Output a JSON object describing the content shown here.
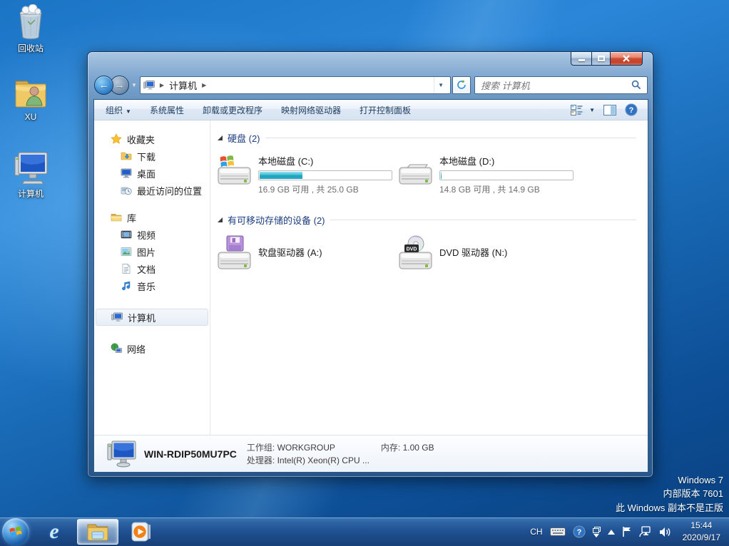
{
  "desktop": {
    "icons": [
      {
        "label": "回收站"
      },
      {
        "label": "XU"
      },
      {
        "label": "计算机"
      }
    ],
    "watermark": {
      "line1": "Windows 7",
      "line2": "内部版本 7601",
      "line3": "此 Windows 副本不是正版"
    }
  },
  "window": {
    "nav": {
      "breadcrumb_root": "计算机",
      "search_placeholder": "搜索 计算机"
    },
    "toolbar": {
      "organize": "组织",
      "items": [
        "系统属性",
        "卸载或更改程序",
        "映射网络驱动器",
        "打开控制面板"
      ]
    },
    "sidebar": {
      "items": [
        {
          "label": "收藏夹"
        },
        {
          "label": "下载"
        },
        {
          "label": "桌面"
        },
        {
          "label": "最近访问的位置"
        },
        {
          "label": "库"
        },
        {
          "label": "视频"
        },
        {
          "label": "图片"
        },
        {
          "label": "文档"
        },
        {
          "label": "音乐"
        },
        {
          "label": "计算机"
        },
        {
          "label": "网络"
        }
      ]
    },
    "content": {
      "groups": [
        {
          "title": "硬盘 (2)",
          "items": [
            {
              "name": "本地磁盘 (C:)",
              "capacity_text": "16.9 GB 可用 , 共 25.0 GB",
              "usage_percent": 32.4
            },
            {
              "name": "本地磁盘 (D:)",
              "capacity_text": "14.8 GB 可用 , 共 14.9 GB",
              "usage_percent": 0.7
            }
          ]
        },
        {
          "title": "有可移动存储的设备 (2)",
          "items": [
            {
              "name": "软盘驱动器 (A:)"
            },
            {
              "name": "DVD 驱动器 (N:)"
            }
          ]
        }
      ],
      "dvd_badge": "DVD"
    },
    "details": {
      "computer_name": "WIN-RDIP50MU7PC",
      "workgroup_label": "工作组:",
      "workgroup_value": "WORKGROUP",
      "memory_label": "内存:",
      "memory_value": "1.00 GB",
      "processor_label": "处理器:",
      "processor_value": "Intel(R) Xeon(R) CPU ..."
    }
  },
  "taskbar": {
    "tray": {
      "input_indicator": "CH",
      "time": "15:44",
      "date": "2020/9/17"
    }
  },
  "colors": {
    "drive_bar_fill": "#2fb4cd",
    "group_header_text": "#1c3e81",
    "taskbar_blue": "#1f5091",
    "close_button_red": "#c2402a"
  }
}
